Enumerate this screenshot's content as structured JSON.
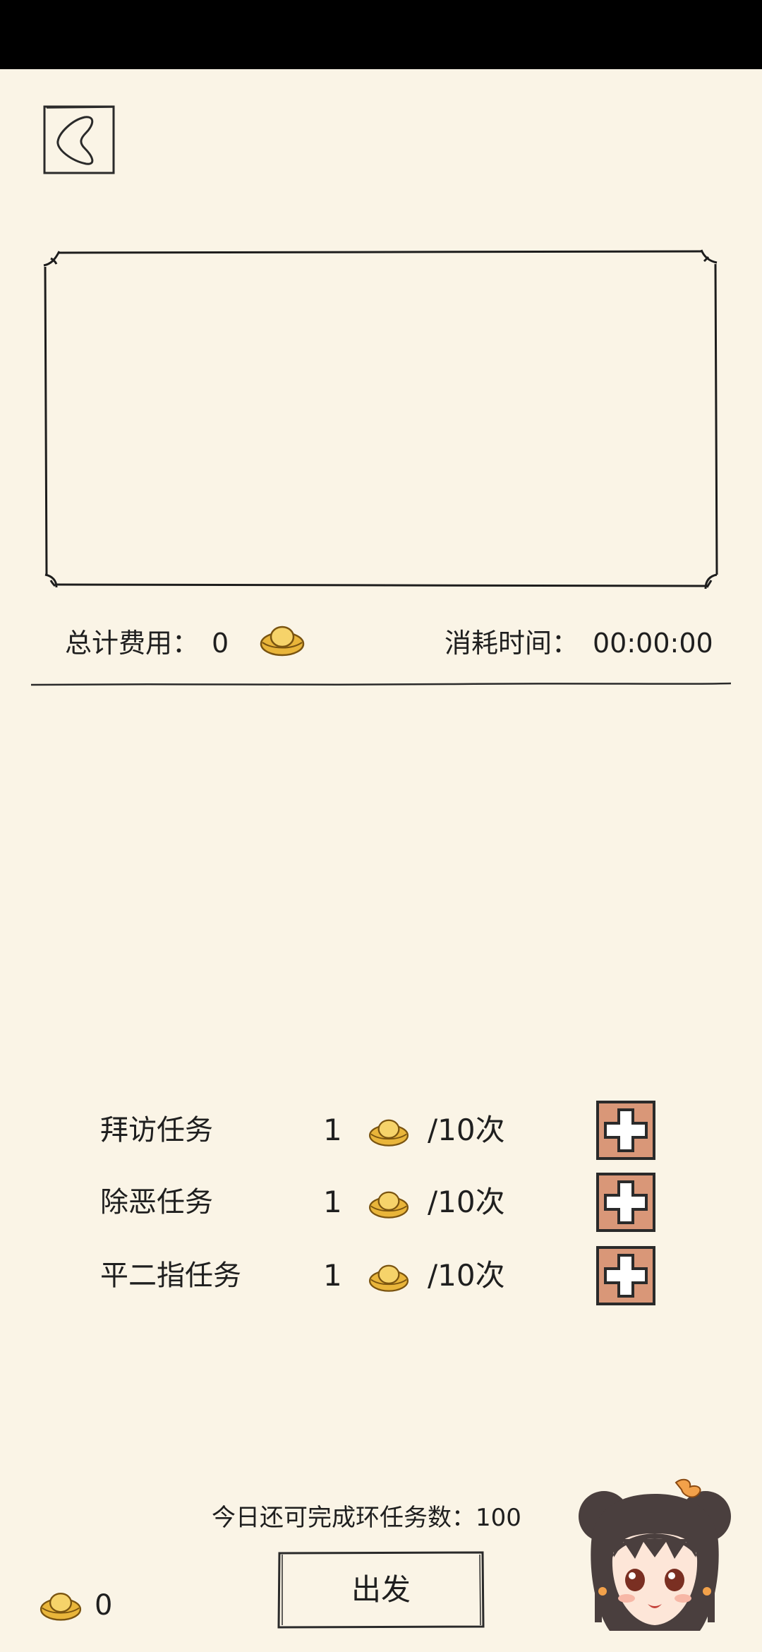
{
  "header": {
    "back_icon": "back-arrow-icon"
  },
  "summary": {
    "cost_label": "总计费用：",
    "cost_value": "0",
    "time_label": "消耗时间：",
    "time_value": "00:00:00",
    "currency_icon": "gold-ingot-icon"
  },
  "tasks": [
    {
      "name": "拜访任务",
      "count": "1",
      "limit": "/10次"
    },
    {
      "name": "除恶任务",
      "count": "1",
      "limit": "/10次"
    },
    {
      "name": "平二指任务",
      "count": "1",
      "limit": "/10次"
    }
  ],
  "footer": {
    "remaining_label": "今日还可完成环任务数：",
    "remaining_value": "100",
    "go_label": "出发",
    "balance_value": "0"
  },
  "colors": {
    "background": "#faf4e6",
    "plus_button": "#d99778",
    "gold": "#e9b53a",
    "ink": "#1f1f1f"
  }
}
